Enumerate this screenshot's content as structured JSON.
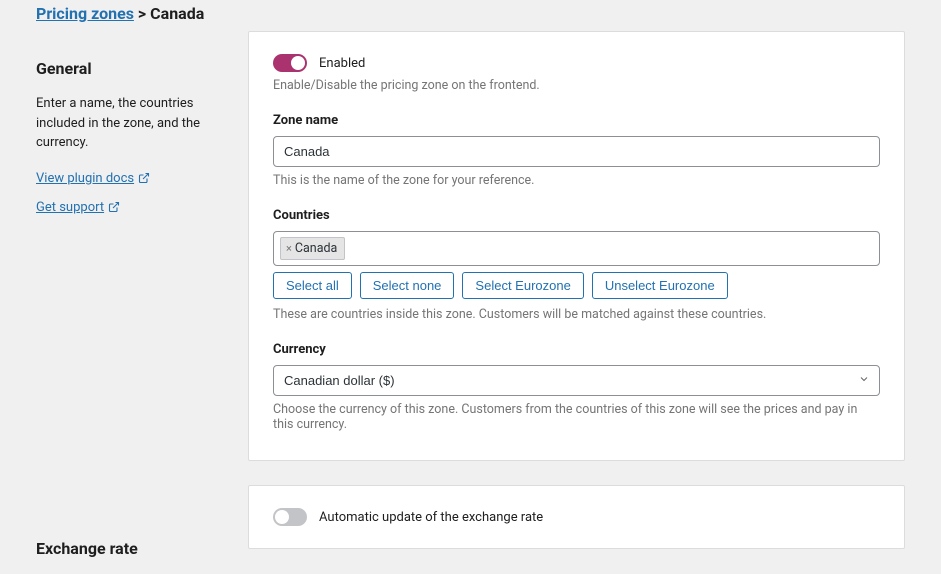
{
  "breadcrumb": {
    "parent": "Pricing zones",
    "separator": ">",
    "current": "Canada"
  },
  "sidebar": {
    "general": {
      "title": "General",
      "desc": "Enter a name, the countries included in the zone, and the currency.",
      "docs_link": "View plugin docs",
      "support_link": "Get support"
    },
    "exchange": {
      "title": "Exchange rate"
    }
  },
  "card_general": {
    "enabled_label": "Enabled",
    "enabled_help": "Enable/Disable the pricing zone on the frontend.",
    "zone_name_label": "Zone name",
    "zone_name_value": "Canada",
    "zone_name_help": "This is the name of the zone for your reference.",
    "countries_label": "Countries",
    "countries_tags": [
      "Canada"
    ],
    "countries_help": "These are countries inside this zone. Customers will be matched against these countries.",
    "btn_select_all": "Select all",
    "btn_select_none": "Select none",
    "btn_select_eurozone": "Select Eurozone",
    "btn_unselect_eurozone": "Unselect Eurozone",
    "currency_label": "Currency",
    "currency_value": "Canadian dollar ($)",
    "currency_help": "Choose the currency of this zone. Customers from the countries of this zone will see the prices and pay in this currency."
  },
  "card_exchange": {
    "auto_update_label": "Automatic update of the exchange rate"
  }
}
